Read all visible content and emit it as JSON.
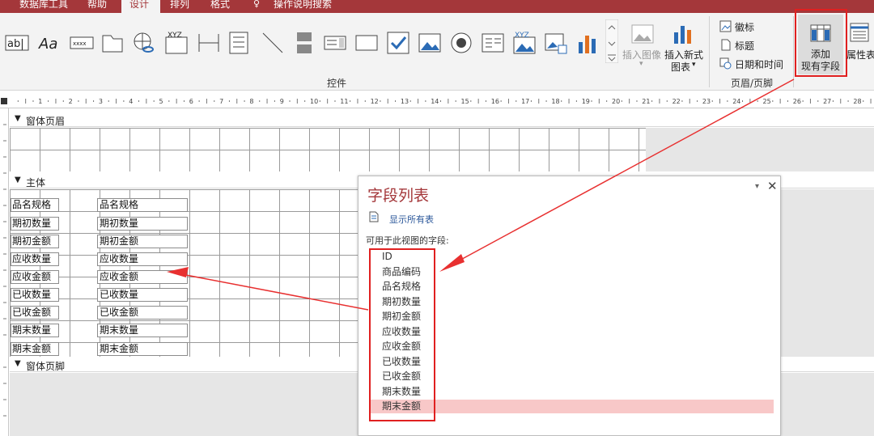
{
  "tabs": [
    "数据库工具",
    "帮助",
    "设计",
    "排列",
    "格式",
    "操作说明搜索"
  ],
  "ribbon": {
    "controls_group_label": "控件",
    "header_footer_group_label": "页眉/页脚",
    "insert_image_label": "插入图像",
    "insert_chart_label1": "插入新式",
    "insert_chart_label2": "图表",
    "logo_label": "徽标",
    "title_label": "标题",
    "datetime_label": "日期和时间",
    "add_fields_label1": "添加",
    "add_fields_label2": "现有字段",
    "property_sheet_label": "属性表",
    "control_icons": [
      "textbox-icon",
      "label-icon",
      "button-icon",
      "tab-control-icon",
      "hyperlink-icon",
      "web-browser-icon",
      "navigation-icon",
      "option-group-icon",
      "page-break-icon",
      "combo-box-icon",
      "line-icon",
      "toggle-icon",
      "listbox-icon",
      "rectangle-icon",
      "checkbox-icon",
      "image-icon",
      "option-button-icon",
      "subform-icon",
      "object-frame-icon",
      "bound-object-icon",
      "attachment-icon",
      "chart-icon"
    ]
  },
  "ruler": {
    "marks": [
      "1",
      "2",
      "3",
      "4",
      "5",
      "6",
      "7",
      "8",
      "9",
      "10",
      "11",
      "12",
      "13",
      "14",
      "15",
      "16",
      "17",
      "18",
      "19",
      "20",
      "21",
      "22",
      "23",
      "24",
      "25",
      "26",
      "27",
      "28"
    ]
  },
  "sections": {
    "header": "窗体页眉",
    "detail": "主体",
    "footer": "窗体页脚"
  },
  "form_fields": [
    {
      "label": "品名规格",
      "box": "品名规格"
    },
    {
      "label": "期初数量",
      "box": "期初数量"
    },
    {
      "label": "期初金额",
      "box": "期初金额"
    },
    {
      "label": "应收数量",
      "box": "应收数量"
    },
    {
      "label": "应收金额",
      "box": "应收金额"
    },
    {
      "label": "已收数量",
      "box": "已收数量"
    },
    {
      "label": "已收金额",
      "box": "已收金额"
    },
    {
      "label": "期末数量",
      "box": "期末数量"
    },
    {
      "label": "期末金额",
      "box": "期末金额"
    }
  ],
  "field_list": {
    "title": "字段列表",
    "show_all": "显示所有表",
    "available_label": "可用于此视图的字段:",
    "fields": [
      "ID",
      "商品编码",
      "品名规格",
      "期初数量",
      "期初金额",
      "应收数量",
      "应收金额",
      "已收数量",
      "已收金额",
      "期末数量",
      "期末金额"
    ],
    "selected_index": 10
  },
  "colors": {
    "accent": "#a4373a",
    "annotation": "#e02020",
    "selection": "#f8c8c8"
  }
}
